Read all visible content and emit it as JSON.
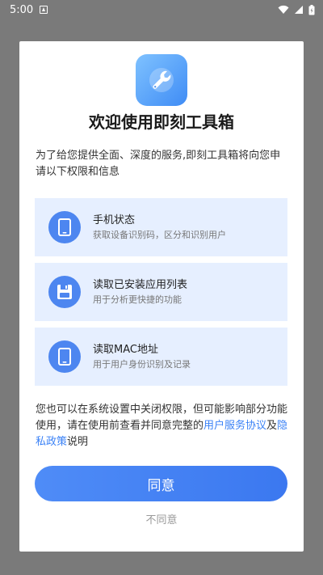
{
  "status_bar": {
    "time": "5:00",
    "icons": [
      "notification-icon",
      "wifi-icon",
      "signal-icon",
      "battery-icon"
    ]
  },
  "dialog": {
    "app_icon": "wrench-icon",
    "title": "欢迎使用即刻工具箱",
    "intro": "为了给您提供全面、深度的服务,即刻工具箱将向您申请以下权限和信息",
    "permissions": [
      {
        "icon": "phone-icon",
        "title": "手机状态",
        "desc": "获取设备识别码，区分和识别用户"
      },
      {
        "icon": "floppy-icon",
        "title": "读取已安装应用列表",
        "desc": "用于分析更快捷的功能"
      },
      {
        "icon": "phone-icon",
        "title": "读取MAC地址",
        "desc": "用于用户身份识别及记录"
      }
    ],
    "notice": {
      "text_before": "您也可以在系统设置中关闭权限，但可能影响部分功能使用，请在使用前查看并同意完整的",
      "link_user_agreement": "用户服务协议",
      "and": "及",
      "link_privacy_policy": "隐私政策",
      "text_after": "说明"
    },
    "agree_label": "同意",
    "disagree_label": "不同意"
  },
  "colors": {
    "accent": "#3b78f0",
    "card_bg": "#e6efff",
    "link": "#3b82f6",
    "backdrop": "#7a7a7a"
  }
}
